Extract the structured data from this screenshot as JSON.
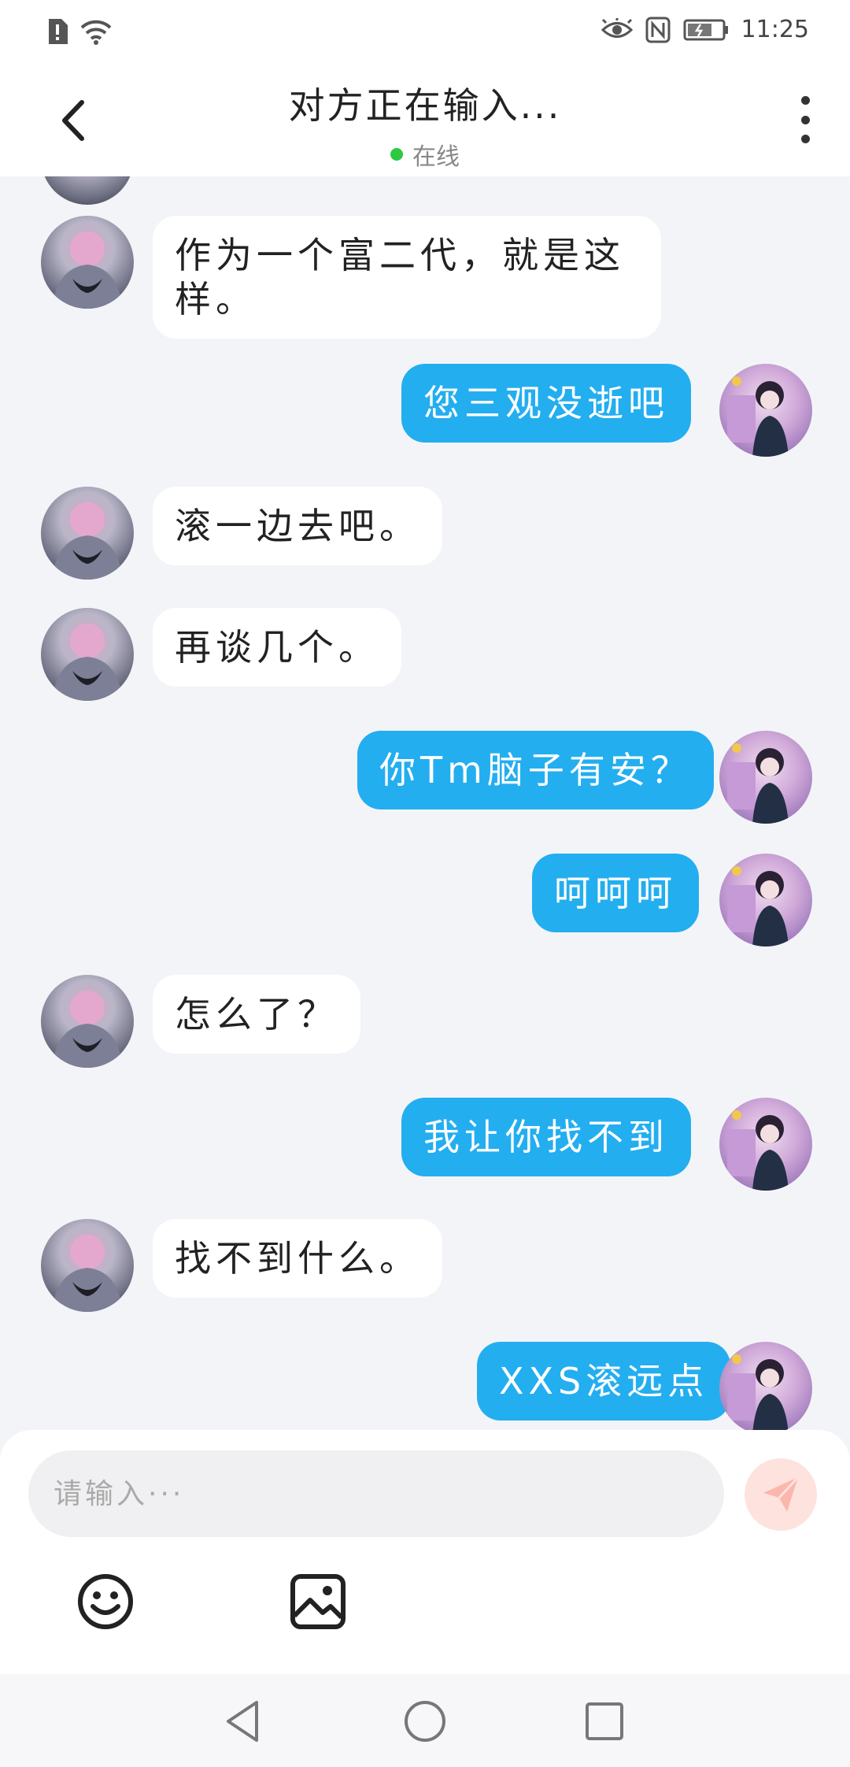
{
  "status_bar": {
    "time": "11:25",
    "icons": [
      "sim-alert-icon",
      "wifi-icon",
      "eye-icon",
      "nfc-icon",
      "battery-icon"
    ]
  },
  "header": {
    "title": "对方正在输入...",
    "status_text": "在线",
    "status_color": "#2ec843"
  },
  "messages": [
    {
      "side": "in",
      "text": "作为一个富二代，就是这样。"
    },
    {
      "side": "out",
      "text": "您三观没逝吧"
    },
    {
      "side": "in",
      "text": "滚一边去吧。"
    },
    {
      "side": "in",
      "text": "再谈几个。"
    },
    {
      "side": "out",
      "text": "你Tm脑子有安？"
    },
    {
      "side": "out",
      "text": "呵呵呵"
    },
    {
      "side": "in",
      "text": "怎么了？"
    },
    {
      "side": "out",
      "text": "我让你找不到"
    },
    {
      "side": "in",
      "text": "找不到什么。"
    },
    {
      "side": "out",
      "text": "XXS滚远点"
    }
  ],
  "input": {
    "placeholder": "请输入···"
  },
  "colors": {
    "outgoing_bubble": "#23aef0",
    "incoming_bubble": "#ffffff",
    "background": "#f3f4f7",
    "send_button": "#fde2de"
  }
}
